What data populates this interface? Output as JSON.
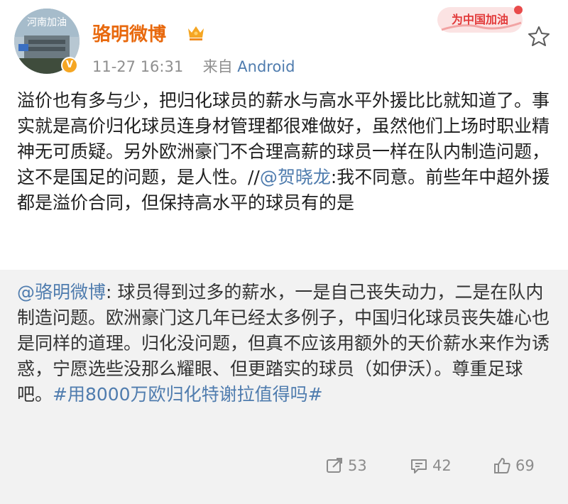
{
  "user": {
    "name": "骆明微博",
    "avatar_text": "河南加油",
    "verified_icon": "verified-badge-icon",
    "vip_icon": "vip-crown-icon"
  },
  "meta": {
    "time": "11-27 16:31",
    "source_prefix": "来自",
    "device": "Android"
  },
  "promo": {
    "text": "为中国加油"
  },
  "post": {
    "text_before": "溢价也有多与少，把归化球员的薪水与高水平外援比比就知道了。事实就是高价归化球员连身材管理都很难做好，虽然他们上场时职业精神无可质疑。另外欧洲豪门不合理高薪的球员一样在队内制造问题，这不是国足的问题，是人性。//",
    "mention": "@贺晓龙",
    "text_after": ":我不同意。前些年中超外援都是溢价合同，但保持高水平的球员有的是"
  },
  "quote": {
    "author_mention": "@骆明微博",
    "text": ": 球员得到过多的薪水，一是自己丧失动力，二是在队内制造问题。欧洲豪门这几年已经太多例子，中国归化球员丧失雄心也是同样的道理。归化没问题，但真不应该用额外的天价薪水来作为诱惑，宁愿选些没那么耀眼、但更踏实的球员（如伊沃）。尊重足球吧。",
    "hashtag": "#用8000万欧归化特谢拉值得吗#"
  },
  "actions": {
    "repost_count": "53",
    "comment_count": "42",
    "like_count": "69"
  },
  "colors": {
    "username": "#e8690e",
    "link": "#4f7cae",
    "quote_bg": "#f2f2f2",
    "meta_gray": "#8f8f8f"
  }
}
